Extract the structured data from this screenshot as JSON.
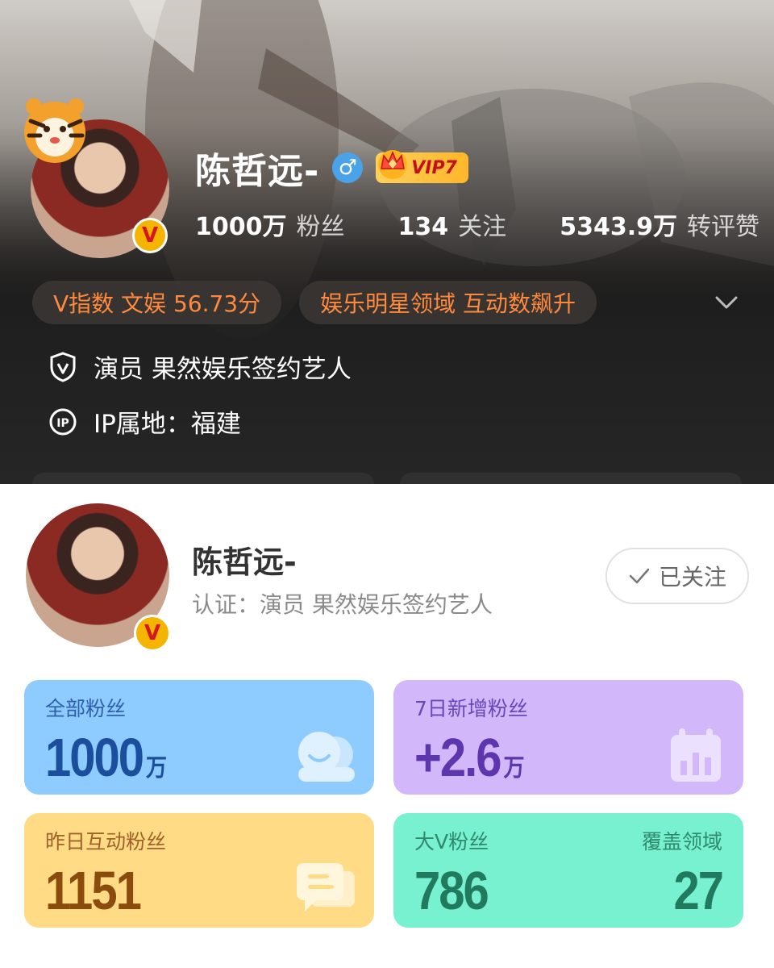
{
  "profile": {
    "name": "陈哲远-",
    "gender_symbol": "♂",
    "vip_label": "VIP7",
    "verified_mark": "V",
    "stats": [
      {
        "value": "1000万",
        "label": "粉丝"
      },
      {
        "value": "134",
        "label": "关注"
      },
      {
        "value": "5343.9万",
        "label": "转评赞"
      }
    ],
    "chips": [
      "V指数 文娱 56.73分",
      "娱乐明星领域 互动数飙升"
    ],
    "verification": "演员 果然娱乐签约艺人",
    "ip_location": "IP属地：福建",
    "colors": {
      "chip_text": "#ff8a3d",
      "vip_gold": "#ffc23a",
      "gender_blue": "#4aa3e8"
    }
  },
  "fan_panel": {
    "name": "陈哲远-",
    "certification": "认证：演员 果然娱乐签约艺人",
    "follow_button": "已关注",
    "verified_mark": "V",
    "cards": {
      "all_fans": {
        "title": "全部粉丝",
        "value": "1000",
        "unit": "万",
        "icon": "fans-icon"
      },
      "new_fans_7d": {
        "title": "7日新增粉丝",
        "value": "+2.6",
        "unit": "万",
        "icon": "calendar-chart-icon"
      },
      "interactive_fans_yesterday": {
        "title": "昨日互动粉丝",
        "value": "1151",
        "icon": "chat-bubble-icon"
      },
      "big_v_fans": {
        "title": "大V粉丝",
        "value": "786",
        "right_title": "覆盖领域",
        "right_value": "27"
      }
    },
    "colors": {
      "blue": "#8ecbff",
      "purple": "#d3b7fb",
      "yellow": "#ffdb85",
      "green": "#77f1d0"
    }
  }
}
